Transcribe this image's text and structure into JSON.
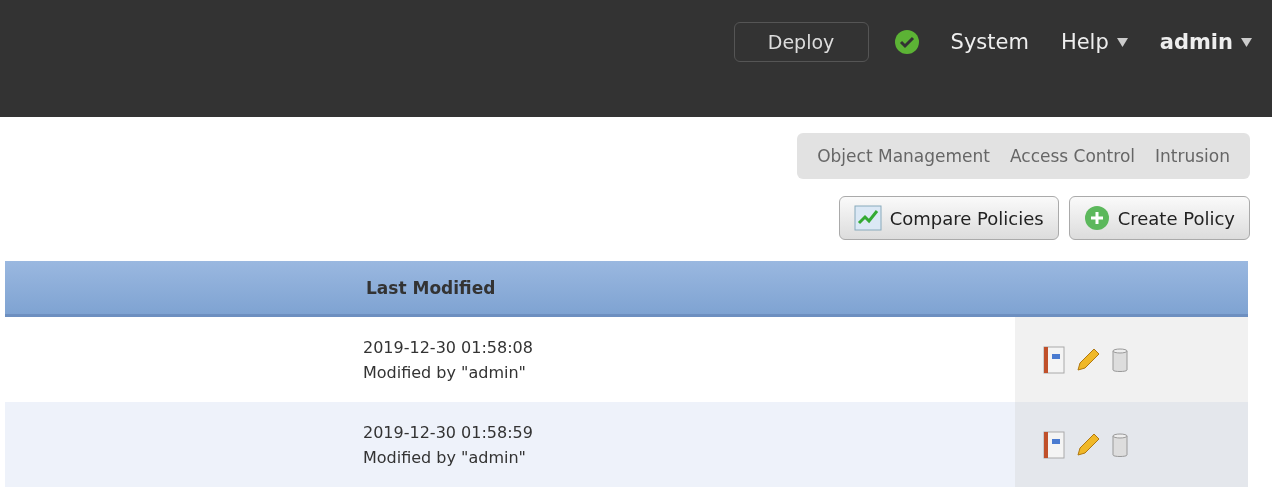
{
  "top_bar": {
    "deploy_button": "Deploy",
    "nav": [
      {
        "label": "System",
        "kind": "link",
        "dropdown": false
      },
      {
        "label": "Help",
        "kind": "link",
        "dropdown": true
      },
      {
        "label": "admin",
        "kind": "user",
        "dropdown": true
      }
    ]
  },
  "sub_nav": [
    "Object Management",
    "Access Control",
    "Intrusion"
  ],
  "actions": [
    {
      "label": "Compare Policies",
      "kind": "compare"
    },
    {
      "label": "Create Policy",
      "kind": "create"
    }
  ],
  "table": {
    "columns": [
      "Last Modified"
    ],
    "rows": [
      {
        "modified": "2019-12-30 01:58:08",
        "modified_by": "Modified by \"admin\""
      },
      {
        "modified": "2019-12-30 01:58:59",
        "modified_by": "Modified by \"admin\""
      }
    ]
  }
}
